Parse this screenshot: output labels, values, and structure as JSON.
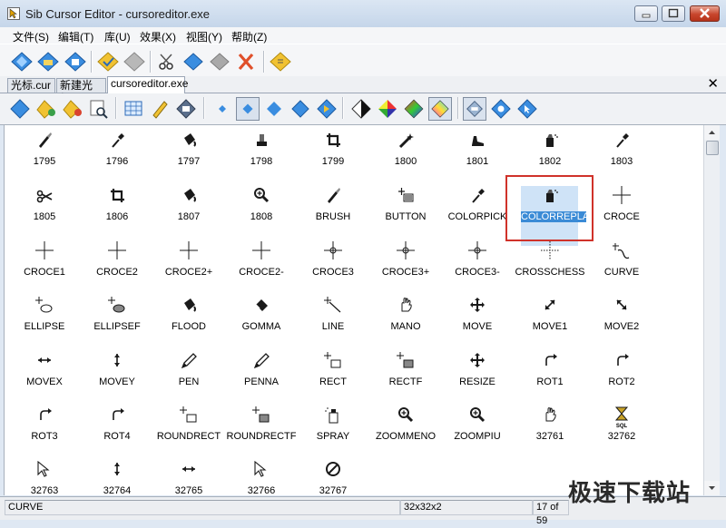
{
  "window": {
    "title": "Sib Cursor Editor - cursoreditor.exe"
  },
  "menu": [
    {
      "id": "file",
      "label": "文件(S)"
    },
    {
      "id": "edit",
      "label": "编辑(T)"
    },
    {
      "id": "library",
      "label": "库(U)"
    },
    {
      "id": "effects",
      "label": "效果(X)"
    },
    {
      "id": "view",
      "label": "视图(Y)"
    },
    {
      "id": "help",
      "label": "帮助(Z)"
    }
  ],
  "toolbar1": [
    "new-icon",
    "open-icon",
    "save-icon",
    "save-all-icon",
    "paste-icon",
    "delete-icon",
    "cut-icon",
    "copy-icon",
    "clear-icon",
    "close-x-icon",
    "properties-icon"
  ],
  "tabs": [
    {
      "label": "光标.cur",
      "active": false
    },
    {
      "label": "新建光标",
      "active": false
    },
    {
      "label": "cursoreditor.exe",
      "active": true
    }
  ],
  "tab_close_label": "✕",
  "toolbar2": [
    "import-icon",
    "add-icon",
    "remove-icon",
    "search-icon",
    "grid-icon",
    "pen-icon",
    "resize-icon",
    "small-icon",
    "medium-icon",
    "large-icon",
    "xlarge-icon",
    "anim-icon",
    "mono-icon",
    "color-icon",
    "palette-icon",
    "truecolor-icon",
    "xp-icon",
    "preview-icon",
    "test-icon"
  ],
  "cursors": [
    {
      "label": "1795",
      "icon": "brush"
    },
    {
      "label": "1796",
      "icon": "dropper"
    },
    {
      "label": "1797",
      "icon": "bucket"
    },
    {
      "label": "1798",
      "icon": "stamp"
    },
    {
      "label": "1799",
      "icon": "crop"
    },
    {
      "label": "1800",
      "icon": "wand"
    },
    {
      "label": "1801",
      "icon": "shoe"
    },
    {
      "label": "1802",
      "icon": "spray"
    },
    {
      "label": "1803",
      "icon": "dropper"
    },
    {
      "label": "1805",
      "icon": "scissors"
    },
    {
      "label": "1806",
      "icon": "crop"
    },
    {
      "label": "1807",
      "icon": "bucket"
    },
    {
      "label": "1808",
      "icon": "zoom"
    },
    {
      "label": "BRUSH",
      "icon": "brush"
    },
    {
      "label": "BUTTON",
      "icon": "button"
    },
    {
      "label": "COLORPICK",
      "icon": "dropper"
    },
    {
      "label": "COLORREPLACE",
      "icon": "spray",
      "selected": true
    },
    {
      "label": "CROCE",
      "icon": "cross"
    },
    {
      "label": "CROCE1",
      "icon": "cross"
    },
    {
      "label": "CROCE2",
      "icon": "cross"
    },
    {
      "label": "CROCE2+",
      "icon": "cross"
    },
    {
      "label": "CROCE2-",
      "icon": "cross"
    },
    {
      "label": "CROCE3",
      "icon": "crosscircle"
    },
    {
      "label": "CROCE3+",
      "icon": "crosscircle"
    },
    {
      "label": "CROCE3-",
      "icon": "crosscircle"
    },
    {
      "label": "CROSSCHESS",
      "icon": "crosschess"
    },
    {
      "label": "CURVE",
      "icon": "curve"
    },
    {
      "label": "ELLIPSE",
      "icon": "ellipse"
    },
    {
      "label": "ELLIPSEF",
      "icon": "ellipsef"
    },
    {
      "label": "FLOOD",
      "icon": "bucket"
    },
    {
      "label": "GOMMA",
      "icon": "eraser"
    },
    {
      "label": "LINE",
      "icon": "line"
    },
    {
      "label": "MANO",
      "icon": "hand"
    },
    {
      "label": "MOVE",
      "icon": "move"
    },
    {
      "label": "MOVE1",
      "icon": "diag1"
    },
    {
      "label": "MOVE2",
      "icon": "diag2"
    },
    {
      "label": "MOVEX",
      "icon": "horiz"
    },
    {
      "label": "MOVEY",
      "icon": "vert"
    },
    {
      "label": "PEN",
      "icon": "pen"
    },
    {
      "label": "PENNA",
      "icon": "pen"
    },
    {
      "label": "RECT",
      "icon": "rect"
    },
    {
      "label": "RECTF",
      "icon": "rectf"
    },
    {
      "label": "RESIZE",
      "icon": "move"
    },
    {
      "label": "ROT1",
      "icon": "rot"
    },
    {
      "label": "ROT2",
      "icon": "rot"
    },
    {
      "label": "ROT3",
      "icon": "rot"
    },
    {
      "label": "ROT4",
      "icon": "rot"
    },
    {
      "label": "ROUNDRECT",
      "icon": "rect"
    },
    {
      "label": "ROUNDRECTF",
      "icon": "rectf"
    },
    {
      "label": "SPRAY",
      "icon": "spraycan"
    },
    {
      "label": "ZOOMMENO",
      "icon": "zoom"
    },
    {
      "label": "ZOOMPIU",
      "icon": "zoom"
    },
    {
      "label": "32761",
      "icon": "hand"
    },
    {
      "label": "32762",
      "icon": "hourglass"
    },
    {
      "label": "32763",
      "icon": "arrow"
    },
    {
      "label": "32764",
      "icon": "vert"
    },
    {
      "label": "32765",
      "icon": "horiz"
    },
    {
      "label": "32766",
      "icon": "arrow"
    },
    {
      "label": "32767",
      "icon": "nosign"
    }
  ],
  "hourglass_text": "SQL",
  "status": {
    "left": "CURVE",
    "size": "32x32x2",
    "position": "17 of 59"
  },
  "watermark": "极速下载站"
}
